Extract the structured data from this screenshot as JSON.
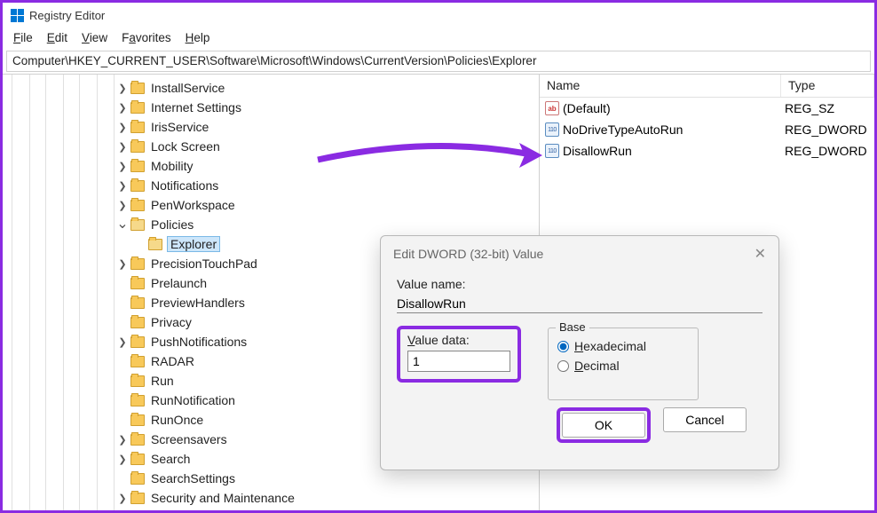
{
  "app": {
    "title": "Registry Editor"
  },
  "menu": {
    "file": "File",
    "edit": "Edit",
    "view": "View",
    "favorites": "Favorites",
    "help": "Help"
  },
  "address": "Computer\\HKEY_CURRENT_USER\\Software\\Microsoft\\Windows\\CurrentVersion\\Policies\\Explorer",
  "tree": {
    "items": [
      {
        "label": "InstallService",
        "exp": ">"
      },
      {
        "label": "Internet Settings",
        "exp": ">"
      },
      {
        "label": "IrisService",
        "exp": ">"
      },
      {
        "label": "Lock Screen",
        "exp": ">"
      },
      {
        "label": "Mobility",
        "exp": ">"
      },
      {
        "label": "Notifications",
        "exp": ">"
      },
      {
        "label": "PenWorkspace",
        "exp": ">"
      },
      {
        "label": "Policies",
        "exp": "v",
        "open": true
      },
      {
        "label": "Explorer",
        "exp": "",
        "child": true,
        "selected": true,
        "open": true
      },
      {
        "label": "PrecisionTouchPad",
        "exp": ">"
      },
      {
        "label": "Prelaunch",
        "exp": ""
      },
      {
        "label": "PreviewHandlers",
        "exp": ""
      },
      {
        "label": "Privacy",
        "exp": ""
      },
      {
        "label": "PushNotifications",
        "exp": ">"
      },
      {
        "label": "RADAR",
        "exp": ""
      },
      {
        "label": "Run",
        "exp": ""
      },
      {
        "label": "RunNotification",
        "exp": ""
      },
      {
        "label": "RunOnce",
        "exp": ""
      },
      {
        "label": "Screensavers",
        "exp": ">"
      },
      {
        "label": "Search",
        "exp": ">"
      },
      {
        "label": "SearchSettings",
        "exp": ""
      },
      {
        "label": "Security and Maintenance",
        "exp": ">"
      }
    ]
  },
  "list": {
    "cols": {
      "name": "Name",
      "type": "Type"
    },
    "rows": [
      {
        "icon": "sz",
        "name": "(Default)",
        "type": "REG_SZ"
      },
      {
        "icon": "dw",
        "name": "NoDriveTypeAutoRun",
        "type": "REG_DWORD"
      },
      {
        "icon": "dw",
        "name": "DisallowRun",
        "type": "REG_DWORD"
      }
    ]
  },
  "dialog": {
    "title": "Edit DWORD (32-bit) Value",
    "value_name_label": "Value name:",
    "value_name": "DisallowRun",
    "value_data_label": "Value data:",
    "value_data": "1",
    "base_label": "Base",
    "hex": "Hexadecimal",
    "dec": "Decimal",
    "ok": "OK",
    "cancel": "Cancel"
  }
}
